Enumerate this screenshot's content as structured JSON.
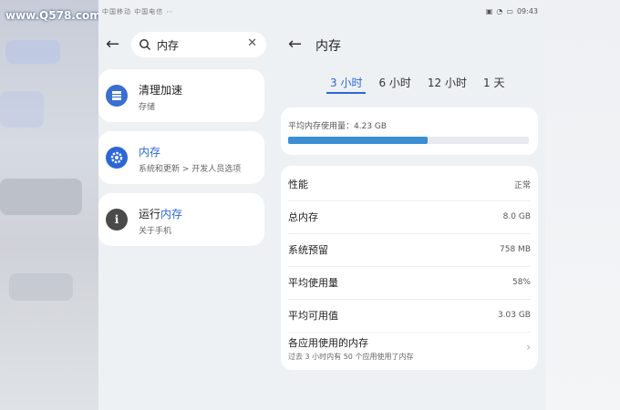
{
  "watermark": "www.Q578.com",
  "status": {
    "left_text": "中国移动 中国电信 ⋯",
    "time": "09:43"
  },
  "search": {
    "query": "内存"
  },
  "results": [
    {
      "title_plain": "清理加速",
      "title_hl": "",
      "subtitle": "存储",
      "icon": "storage-icon",
      "icon_color": "#3a6fd0"
    },
    {
      "title_plain": "",
      "title_hl": "内存",
      "subtitle": "系统和更新 > 开发人员选项",
      "icon": "gear-icon",
      "icon_color": "#2b67d6"
    },
    {
      "title_plain": "运行",
      "title_hl": "内存",
      "subtitle": "关于手机",
      "icon": "info-icon",
      "icon_color": "#4a4a4a"
    }
  ],
  "detail": {
    "title": "内存",
    "tabs": [
      "3 小时",
      "6 小时",
      "12 小时",
      "1 天"
    ],
    "active_tab": 0,
    "usage_label": "平均内存使用量：",
    "usage_value": "4.23 GB",
    "usage_fraction": 0.58,
    "accent": "#2b67d6",
    "rows": [
      {
        "label": "性能",
        "value": "正常"
      },
      {
        "label": "总内存",
        "value": "8.0 GB"
      },
      {
        "label": "系统预留",
        "value": "758 MB"
      },
      {
        "label": "平均使用量",
        "value": "58%"
      },
      {
        "label": "平均可用值",
        "value": "3.03 GB"
      }
    ],
    "apps_title": "各应用使用的内存",
    "apps_sub": "过去 3 小时内有 50 个应用使用了内存"
  }
}
